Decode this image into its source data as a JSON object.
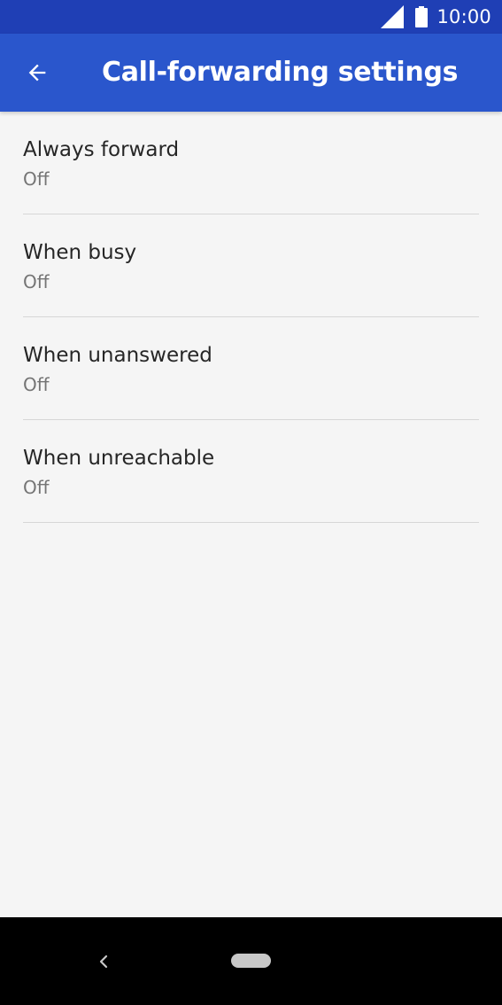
{
  "status_bar": {
    "time": "10:00",
    "icons": [
      "signal-icon",
      "battery-icon"
    ]
  },
  "app_bar": {
    "back_icon": "arrow-left-icon",
    "title": "Call-forwarding settings"
  },
  "settings": {
    "items": [
      {
        "title": "Always forward",
        "summary": "Off"
      },
      {
        "title": "When busy",
        "summary": "Off"
      },
      {
        "title": "When unanswered",
        "summary": "Off"
      },
      {
        "title": "When unreachable",
        "summary": "Off"
      }
    ]
  },
  "nav_bar": {
    "back_icon": "nav-back-chevron-icon",
    "home_icon": "home-pill-icon"
  },
  "colors": {
    "status_bar": "#1f3fb5",
    "app_bar": "#2a56cc",
    "background": "#f5f5f5",
    "title_text": "#262626",
    "summary_text": "#757575",
    "divider": "#d6d6d6",
    "nav_bar": "#000000"
  }
}
